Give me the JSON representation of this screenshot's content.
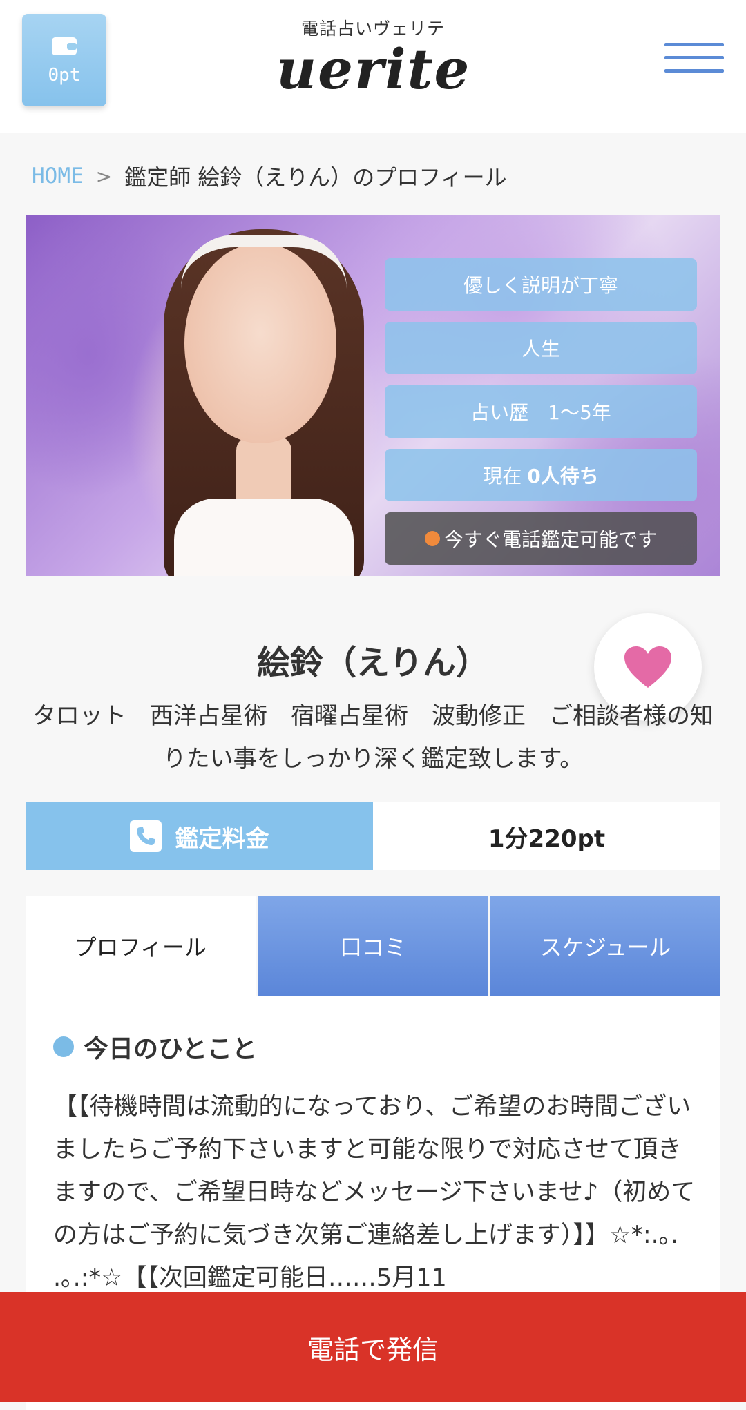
{
  "header": {
    "points_label": "0pt",
    "logo_sub": "電話占いヴェリテ",
    "logo_main": "uerite"
  },
  "breadcrumb": {
    "home": "HOME",
    "separator": ">",
    "current": "鑑定師  絵鈴（えりん）のプロフィール"
  },
  "hero": {
    "tags": [
      "優しく説明が丁寧",
      "人生",
      "占い歴　1〜5年"
    ],
    "waiting_prefix": "現在",
    "waiting_value": "0人待ち",
    "status": "今すぐ電話鑑定可能です",
    "status_color": "#f08a3c"
  },
  "profile": {
    "name": "絵鈴（えりん）",
    "description": "タロット　西洋占星術　宿曜占星術　波動修正　ご相談者様の知りたい事をしっかり深く鑑定致します。"
  },
  "fee": {
    "label": "鑑定料金",
    "value": "1分220pt"
  },
  "tabs": [
    "プロフィール",
    "口コミ",
    "スケジュール"
  ],
  "today": {
    "title": "今日のひとこと",
    "message": "【【待機時間は流動的になっており、ご希望のお時間ございましたらご予約下さいますと可能な限りで対応させて頂きますので、ご希望日時などメッセージ下さいませ♪（初めての方はご予約に気づき次第ご連絡差し上げます）】】☆*:.｡. .｡.:*☆【【次回鑑定可能日……5月11"
  },
  "call_button": "電話で発信",
  "colors": {
    "accent_blue": "#86c2ec",
    "tab_blue": "#5b86d9",
    "call_red": "#d93328",
    "heart_pink": "#e46aa6"
  }
}
